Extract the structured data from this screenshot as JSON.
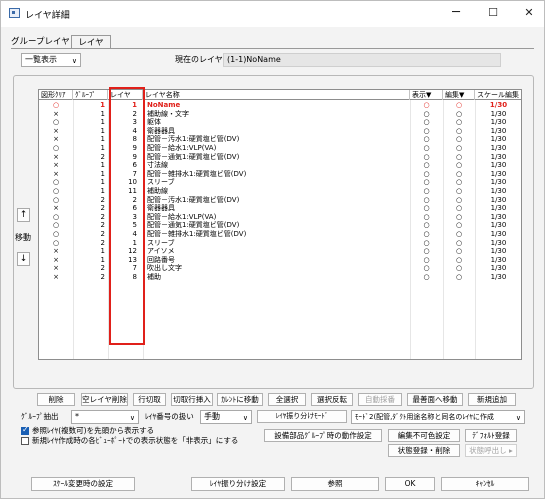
{
  "window": {
    "title": "レイヤ詳細",
    "minimize": "─",
    "maximize": "☐",
    "close": "✕"
  },
  "tabs": [
    "グループレイヤ",
    "レイヤ"
  ],
  "view_combo": "一覧表示",
  "current_label": "現在のレイヤ",
  "current_value": "(1-1)NoName",
  "headers": [
    "図形ｸﾘｱ",
    "ｸﾞﾙｰﾌﾟ",
    "レイヤ",
    "レイヤ名称",
    "表示▼",
    "編集▼",
    "スケール編集"
  ],
  "rows": [
    [
      "○",
      "1",
      "1",
      "NoName",
      "○",
      "○",
      "1/30"
    ],
    [
      "×",
      "1",
      "2",
      "補助線・文字",
      "○",
      "○",
      "1/30"
    ],
    [
      "○",
      "1",
      "3",
      "躯体",
      "○",
      "○",
      "1/30"
    ],
    [
      "×",
      "1",
      "4",
      "衛器器具",
      "○",
      "○",
      "1/30"
    ],
    [
      "×",
      "1",
      "8",
      "配管－汚水1:硬質塩ビ管(DV)",
      "○",
      "○",
      "1/30"
    ],
    [
      "○",
      "1",
      "9",
      "配管－給水1:VLP(VA)",
      "○",
      "○",
      "1/30"
    ],
    [
      "×",
      "2",
      "9",
      "配管－通気1:硬質塩ビ管(DV)",
      "○",
      "○",
      "1/30"
    ],
    [
      "×",
      "1",
      "6",
      "寸法線",
      "○",
      "○",
      "1/30"
    ],
    [
      "×",
      "1",
      "7",
      "配管－雑排水1:硬質塩ビ管(DV)",
      "○",
      "○",
      "1/30"
    ],
    [
      "○",
      "1",
      "10",
      "スリーブ",
      "○",
      "○",
      "1/30"
    ],
    [
      "○",
      "1",
      "11",
      "補助線",
      "○",
      "○",
      "1/30"
    ],
    [
      "○",
      "2",
      "2",
      "配管－汚水1:硬質塩ビ管(DV)",
      "○",
      "○",
      "1/30"
    ],
    [
      "×",
      "2",
      "6",
      "衛器器具",
      "○",
      "○",
      "1/30"
    ],
    [
      "○",
      "2",
      "3",
      "配管－給水1:VLP(VA)",
      "○",
      "○",
      "1/30"
    ],
    [
      "○",
      "2",
      "5",
      "配管－通気1:硬質塩ビ管(DV)",
      "○",
      "○",
      "1/30"
    ],
    [
      "○",
      "2",
      "4",
      "配管－雑排水1:硬質塩ビ管(DV)",
      "○",
      "○",
      "1/30"
    ],
    [
      "○",
      "2",
      "1",
      "スリーブ",
      "○",
      "○",
      "1/30"
    ],
    [
      "×",
      "1",
      "12",
      "アイソメ",
      "○",
      "○",
      "1/30"
    ],
    [
      "×",
      "1",
      "13",
      "回路番号",
      "○",
      "○",
      "1/30"
    ],
    [
      "×",
      "2",
      "7",
      "吹出し文字",
      "○",
      "○",
      "1/30"
    ],
    [
      "×",
      "2",
      "8",
      "補助",
      "○",
      "○",
      "1/30"
    ]
  ],
  "move_label": "移動",
  "move_up": "↑",
  "move_down": "↓",
  "buttons1": [
    "削除",
    "空レイヤ削除",
    "行切取",
    "切取行挿入",
    "ｶﾚﾝﾄに移動",
    "全選択",
    "選択反転",
    "自動採番",
    "最善面へ移動",
    "新規追加"
  ],
  "group_extract_label": "ｸﾞﾙｰﾌﾟ抽出",
  "group_extract_value": "*",
  "layer_num_label": "ﾚｲﾔ番号の扱い",
  "layer_num_value": "手動",
  "layer_split_mode_label": "ﾚｲﾔ振り分けﾓｰﾄﾞ",
  "layer_split_mode_value": "ﾓｰﾄﾞ2(配管,ﾀﾞｸﾄ用途名称と同名のﾚｲﾔに作成",
  "check1": "参照ﾚｲﾔ(複数可)を先頭から表示する",
  "check2": "新規ﾚｲﾔ作成時の各ﾋﾞｭｰﾎﾟｰﾄでの表示状態を「非表示」にする",
  "buttons2": [
    "設備部品ｸﾞﾙｰﾌﾟ時の動作設定",
    "編集不可色設定",
    "ﾃﾞﾌｫﾙﾄ登録"
  ],
  "buttons3": [
    "状態登録・削除",
    "状態呼出し ▸"
  ],
  "bottom_buttons": [
    "ｽｹｰﾙ変更時の設定",
    "ﾚｲﾔ振り分け設定",
    "参照",
    "OK",
    "ｷｬﾝｾﾙ"
  ]
}
